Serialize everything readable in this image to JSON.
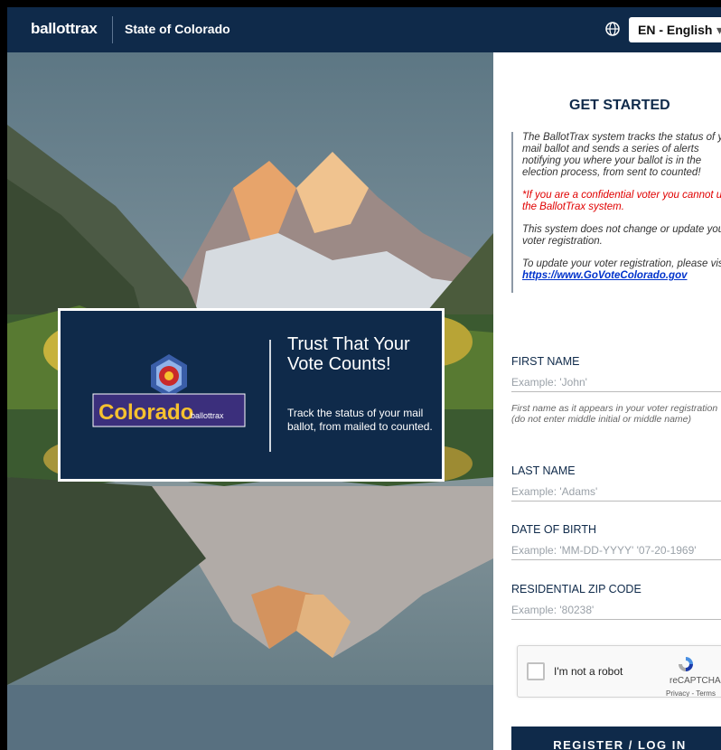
{
  "header": {
    "logo_text": "ballottrax",
    "state_label": "State of Colorado",
    "language_select": "EN - English",
    "globe_icon": "globe-icon"
  },
  "promo": {
    "heading": "Trust That Your Vote Counts!",
    "subtext": "Track the status of your mail ballot, from mailed to counted.",
    "badge_text": "Colorado",
    "badge_small": "ballottrax"
  },
  "panel": {
    "title": "GET STARTED",
    "info": {
      "p1": "The BallotTrax system tracks the status of your mail ballot and sends a series of alerts notifying you where your ballot is in the election process, from sent to counted!",
      "p2": "*If you are a confidential voter you cannot use the BallotTrax system.",
      "p3": "This system does not change or update your voter registration.",
      "p4_prefix": "To update your voter registration, please visit ",
      "p4_link": "https://www.GoVoteColorado.gov"
    },
    "fields": {
      "first_name": {
        "label": "FIRST NAME",
        "placeholder": "Example: 'John'",
        "help": "First name as it appears in your voter registration (do not enter middle initial or middle name)"
      },
      "last_name": {
        "label": "LAST NAME",
        "placeholder": "Example: 'Adams'"
      },
      "dob": {
        "label": "DATE OF BIRTH",
        "placeholder": "Example: 'MM-DD-YYYY' '07-20-1969'"
      },
      "zip": {
        "label": "RESIDENTIAL ZIP CODE",
        "placeholder": "Example: '80238'"
      }
    },
    "captcha": {
      "label": "I'm not a robot",
      "brand": "reCAPTCHA",
      "terms": "Privacy - Terms"
    },
    "register_button": "REGISTER / LOG IN"
  },
  "colors": {
    "navy": "#0f2a4a",
    "warning": "#e00000",
    "link": "#0033cc"
  }
}
